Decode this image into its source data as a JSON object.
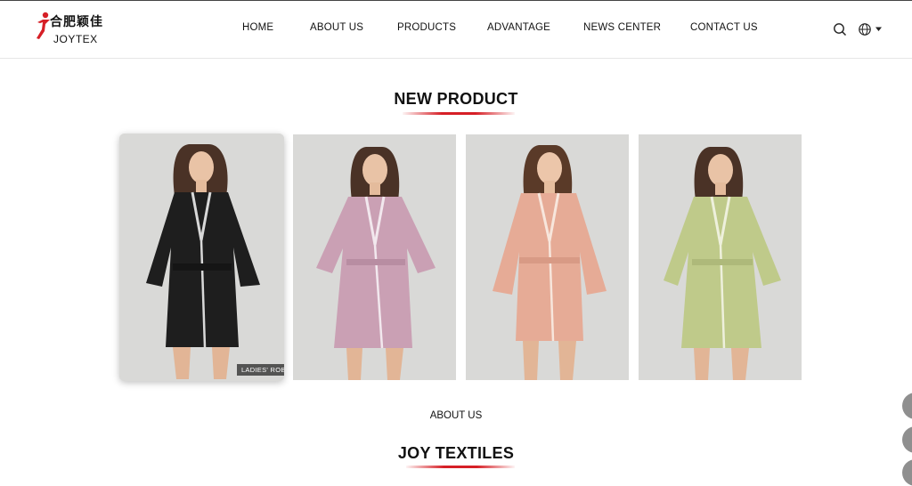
{
  "header": {
    "logo_cn": "合肥颖佳",
    "logo_en": "JOYTEX",
    "nav": [
      {
        "label": "HOME"
      },
      {
        "label": "ABOUT US"
      },
      {
        "label": "PRODUCTS"
      },
      {
        "label": "ADVANTAGE"
      },
      {
        "label": "NEWS CENTER"
      },
      {
        "label": "CONTACT US"
      }
    ],
    "search_icon": "search-icon",
    "language_icon": "globe-icon"
  },
  "new_product": {
    "title": "NEW PRODUCT",
    "items": [
      {
        "tag": "LADIES' ROBE",
        "robe_color": "#1e1e1e",
        "trim_color": "#d8d8d8"
      },
      {
        "tag": "",
        "robe_color": "#caa0b4",
        "trim_color": "#f2e8ee"
      },
      {
        "tag": "",
        "robe_color": "#e6ab96",
        "trim_color": "#f7e6dc"
      },
      {
        "tag": "",
        "robe_color": "#bfca8a",
        "trim_color": "#eef0dc"
      }
    ]
  },
  "about": {
    "link_label": "ABOUT US",
    "title": "JOY TEXTILES"
  },
  "colors": {
    "accent": "#d61f26",
    "background": "#ffffff",
    "photo_bg": "#d9d9d7"
  }
}
